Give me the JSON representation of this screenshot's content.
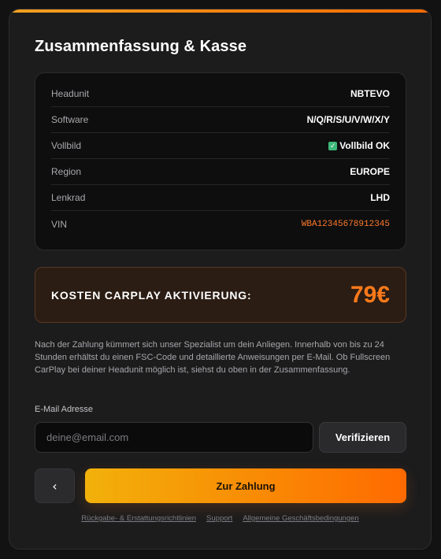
{
  "header": {
    "title": "Zusammenfassung & Kasse"
  },
  "summary": {
    "rows": [
      {
        "label": "Headunit",
        "value": "NBTEVO"
      },
      {
        "label": "Software",
        "value": "N/Q/R/S/U/V/W/X/Y"
      },
      {
        "label": "Vollbild",
        "value": "Vollbild OK",
        "icon": "check-icon"
      },
      {
        "label": "Region",
        "value": "EUROPE"
      },
      {
        "label": "Lenkrad",
        "value": "LHD"
      },
      {
        "label": "VIN",
        "value": "WBA12345678912345"
      }
    ]
  },
  "cost": {
    "label": "KOSTEN CARPLAY AKTIVIERUNG:",
    "price": "79€"
  },
  "info_text": "Nach der Zahlung kümmert sich unser Spezialist um dein Anliegen. Innerhalb von bis zu 24 Stunden erhältst du einen FSC-Code und detaillierte Anweisungen per E-Mail. Ob Fullscreen CarPlay bei deiner Headunit möglich ist, siehst du oben in der Zusammenfassung.",
  "email": {
    "label": "E-Mail Adresse",
    "placeholder": "deine@email.com",
    "value": "",
    "verify_label": "Verifizieren"
  },
  "actions": {
    "back_label": "‹",
    "pay_label": "Zur Zahlung"
  },
  "footer": {
    "links": [
      "Rückgabe- & Erstattungsrichtlinien",
      "Support",
      "Allgemeine Geschäftsbedingungen"
    ]
  },
  "colors": {
    "accent": "#ff7a1a",
    "accent_gradient_start": "#f2b10a",
    "success": "#3cb878"
  }
}
